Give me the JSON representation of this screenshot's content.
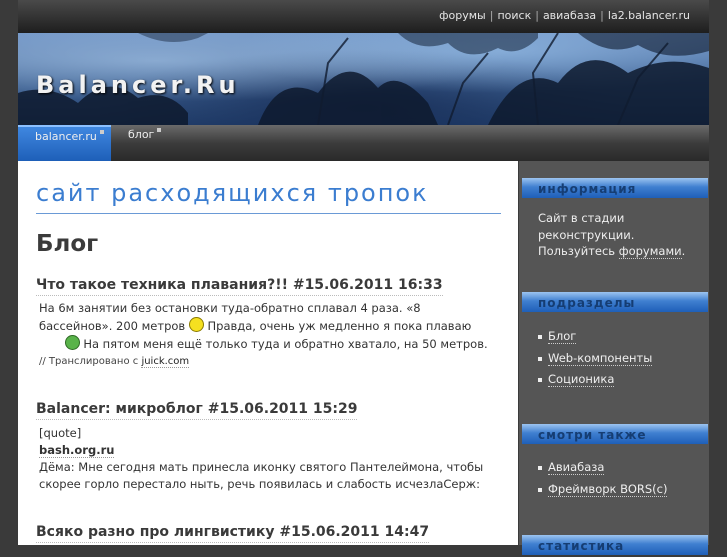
{
  "top_links": [
    "форумы",
    "поиск",
    "авиабаза",
    "la2.balancer.ru"
  ],
  "site_title": "Balancer.Ru",
  "nav": {
    "items": [
      {
        "label": "balancer.ru"
      },
      {
        "label": "блог"
      }
    ]
  },
  "main": {
    "site_heading": "сайт расходящихся тропок",
    "page_title": "Блог",
    "posts": [
      {
        "title": "Что такое техника плавания?!! #15.06.2011 16:33",
        "text_a": "На 6м занятии без остановки туда-обратно сплавал 4 раза. «8 бассейнов». 200 метров",
        "text_b": "Правда, очень уж медленно я пока плаваю",
        "text_c": "На пятом меня ещё только туда и обратно хватало, на 50 метров.",
        "meta_prefix": "// Транслировано с ",
        "meta_link": "juick.com"
      },
      {
        "title": "Balancer: микроблог #15.06.2011 15:29",
        "quote_tag": "[quote]",
        "source": "bash.org.ru",
        "text": "Дёма: Мне сегодня мать принесла иконку святого Пантелеймона, чтобы скорее горло перестало ныть, речь появилась и слабость исчезлаСерж:"
      },
      {
        "title": "Всяко разно про лингвистику #15.06.2011 14:47"
      }
    ]
  },
  "sidebar": {
    "info": {
      "heading": "информация",
      "text_a": "Сайт в стадии реконструкции. Пользуйтесь ",
      "link": "форумами",
      "text_b": "."
    },
    "sections": {
      "heading": "подразделы",
      "items": [
        "Блог",
        "Web-компоненты",
        "Соционика"
      ]
    },
    "see_also": {
      "heading": "смотри также",
      "items": [
        "Авиабаза",
        "Фреймворк BORS(c)"
      ]
    },
    "stats": {
      "heading": "статистика"
    }
  }
}
